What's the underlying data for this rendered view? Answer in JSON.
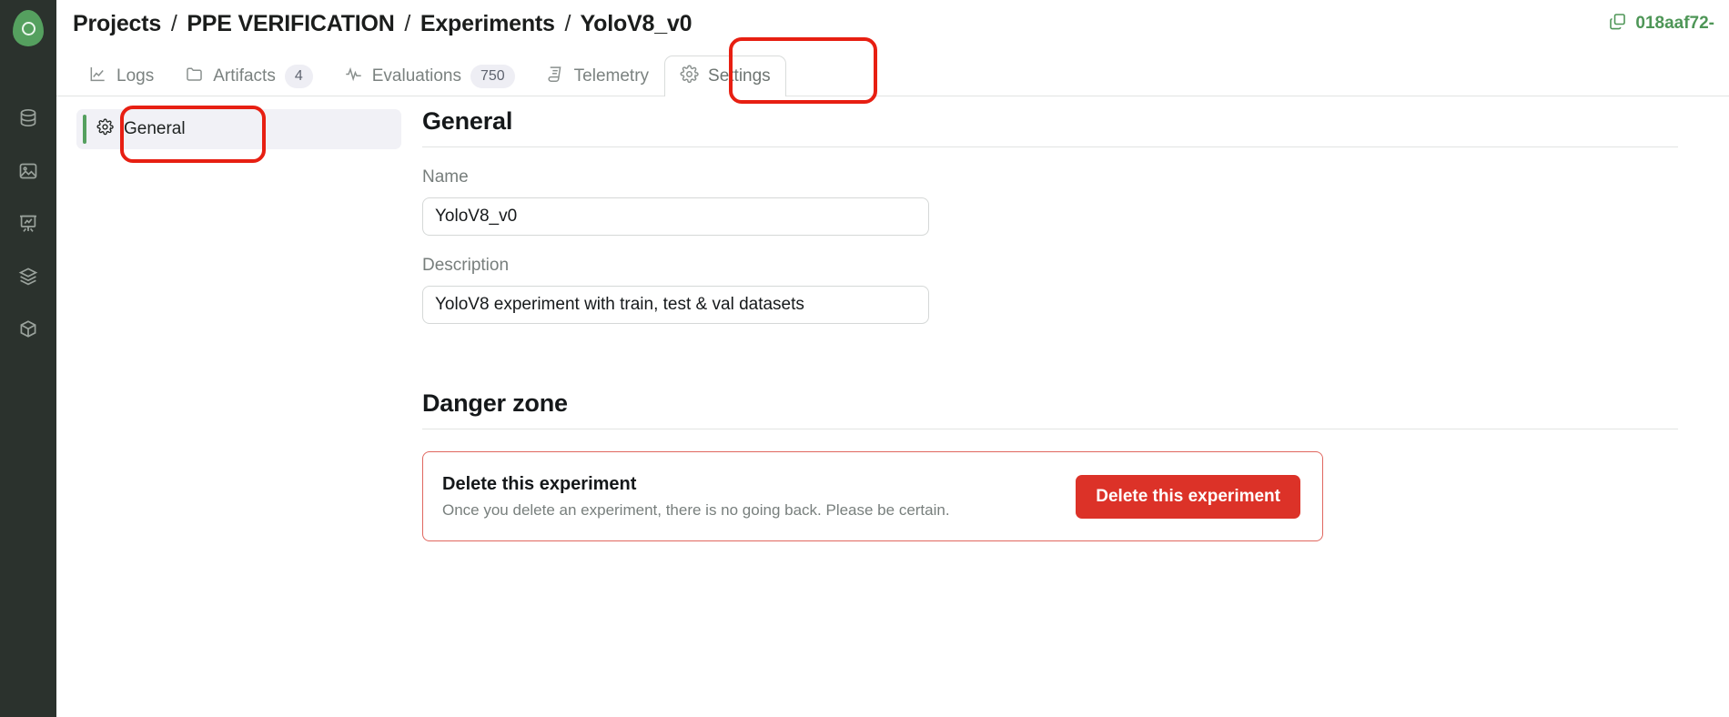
{
  "brand": {
    "logo_icon": "circle-logo-icon",
    "accent_green": "#55a05f"
  },
  "rail": {
    "items": [
      {
        "icon": "database-icon",
        "name": "datasets"
      },
      {
        "icon": "image-icon",
        "name": "images"
      },
      {
        "icon": "presentation-chart-icon",
        "name": "experiments"
      },
      {
        "icon": "layers-icon",
        "name": "models"
      },
      {
        "icon": "box-plus-icon",
        "name": "add-resource"
      }
    ]
  },
  "header": {
    "breadcrumb": [
      "Projects",
      "PPE VERIFICATION",
      "Experiments",
      "YoloV8_v0"
    ],
    "separator": "/",
    "experiment_id": "018aaf72-",
    "copy_icon": "copy-icon"
  },
  "tabs": [
    {
      "label": "Logs",
      "icon": "line-chart-icon",
      "badge": null,
      "active": false
    },
    {
      "label": "Artifacts",
      "icon": "folder-icon",
      "badge": "4",
      "active": false
    },
    {
      "label": "Evaluations",
      "icon": "activity-icon",
      "badge": "750",
      "active": false
    },
    {
      "label": "Telemetry",
      "icon": "telemetry-icon",
      "badge": null,
      "active": false
    },
    {
      "label": "Settings",
      "icon": "gear-icon",
      "badge": null,
      "active": true
    }
  ],
  "sidebar": {
    "items": [
      {
        "label": "General",
        "icon": "gear-icon",
        "selected": true
      }
    ]
  },
  "general": {
    "heading": "General",
    "name_label": "Name",
    "name_value": "YoloV8_v0",
    "name_placeholder": "Name",
    "description_label": "Description",
    "description_value": "YoloV8 experiment with train, test & val datasets",
    "description_placeholder": "Description"
  },
  "danger_zone": {
    "heading": "Danger zone",
    "card_title": "Delete this experiment",
    "card_subtitle": "Once you delete an experiment, there is no going back. Please be certain.",
    "button_label": "Delete this experiment",
    "button_color": "#dc3228",
    "border_color": "#e0675f"
  },
  "annotations": {
    "highlight_color": "#e71f12",
    "regions": [
      "settings-tab",
      "sidebar-general-item"
    ]
  }
}
